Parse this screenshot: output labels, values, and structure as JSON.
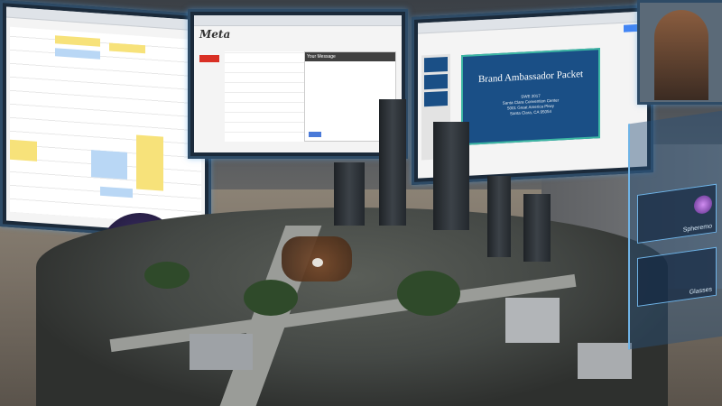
{
  "slides": {
    "title": "Brand Ambassador Packet",
    "subtitle_lines": [
      "SWE 2017",
      "Santa Clara Convention Center",
      "5001 Great America Pkwy",
      "Santa Clara, CA 95054"
    ]
  },
  "mail": {
    "logo": "Meta",
    "message_header": "Your Message"
  },
  "side_menu": {
    "items": [
      {
        "label": "Spheremo",
        "icon": "sphere-icon"
      },
      {
        "label": "Glasses",
        "icon": "glasses-icon"
      }
    ]
  },
  "colors": {
    "panel_border": "#2e4b66",
    "slide_bg": "#1a4f86",
    "slide_accent": "#3cb6a3",
    "calendar_event_yellow": "#f7e27a",
    "calendar_event_blue": "#b9d7f5",
    "mail_compose_red": "#d93025"
  }
}
